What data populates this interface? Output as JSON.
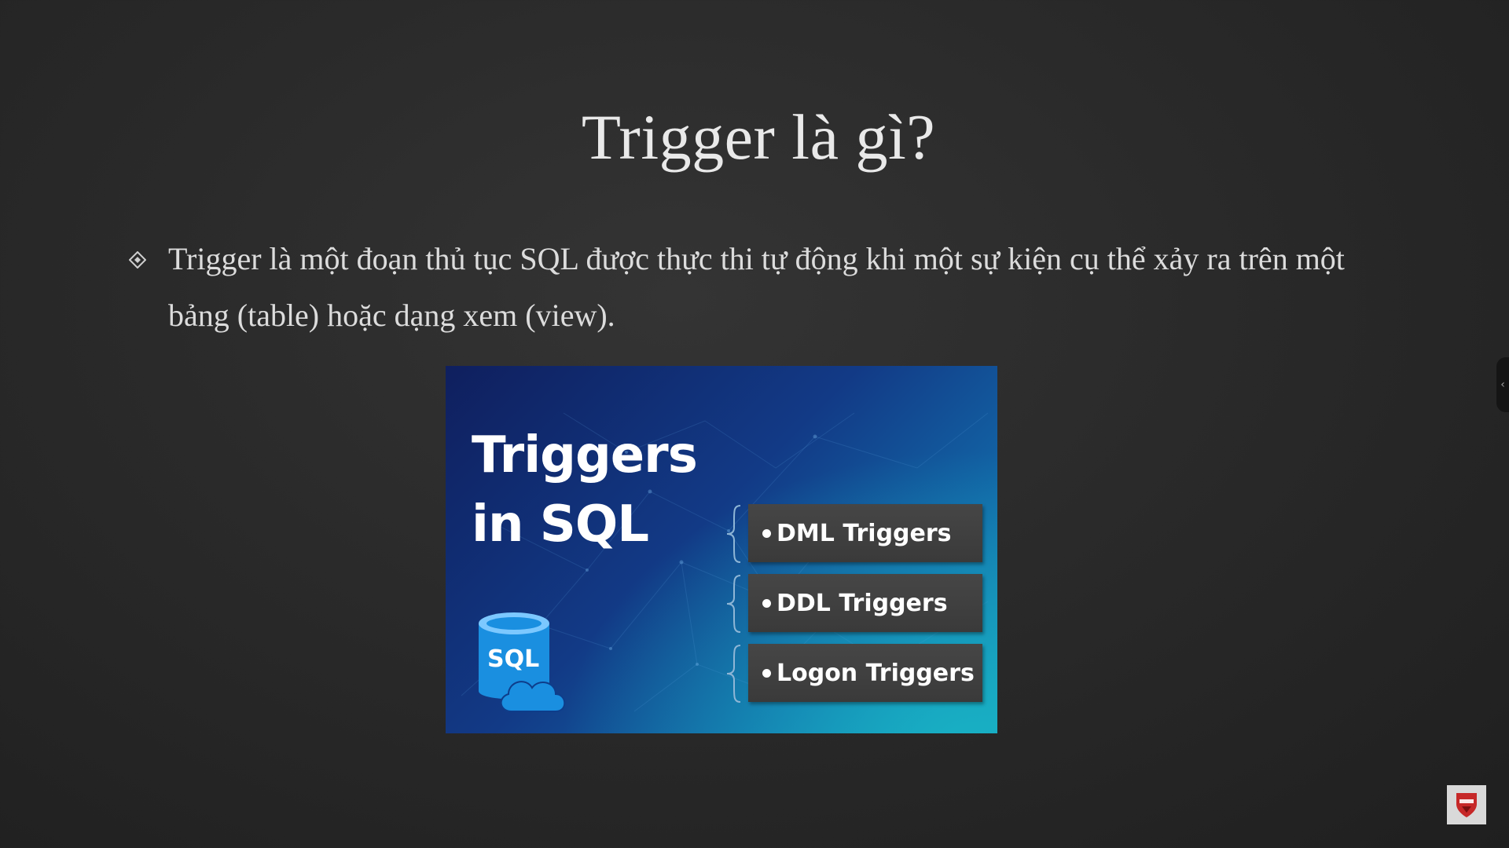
{
  "slide": {
    "title": "Trigger là gì?",
    "bullet_text": "Trigger là một đoạn thủ tục SQL được thực thi tự động khi một sự kiện cụ thể xảy ra trên một bảng (table) hoặc dạng xem (view)."
  },
  "figure": {
    "title_line1": "Triggers",
    "title_line2": "in SQL",
    "db_label": "SQL",
    "types": [
      {
        "label": "DML Triggers"
      },
      {
        "label": "DDL Triggers"
      },
      {
        "label": "Logon Triggers"
      }
    ]
  },
  "icons": {
    "bullet": "diamond-bullet-icon",
    "database": "sql-database-cloud-icon",
    "side_tab": "chevron-left-icon",
    "corner_logo": "shield-logo-icon"
  },
  "colors": {
    "background": "#2a2a2a",
    "title_text": "#e9e9e9",
    "body_text": "#dcdcdc",
    "figure_dark_blue": "#0f1f5e",
    "figure_teal": "#18b1c4",
    "db_icon_blue": "#1a8fe0",
    "type_box": "#404040",
    "logo_red": "#c62828"
  }
}
